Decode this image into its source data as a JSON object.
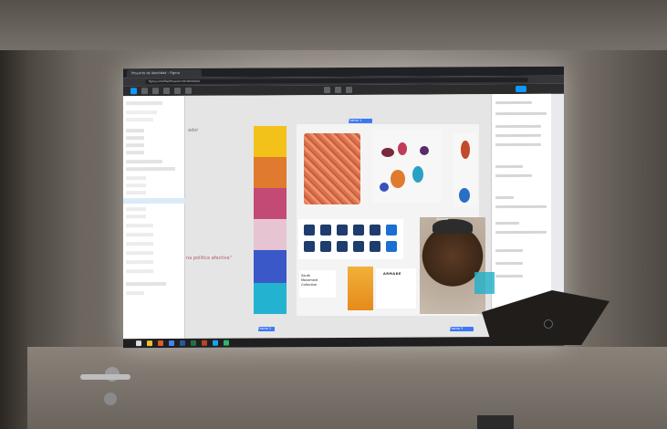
{
  "browser": {
    "tab_title": "Proyecto de Identidad – Figma",
    "url": "figma.com/file/Proyecto-de-Identidad"
  },
  "canvas": {
    "text_left_top": "ador",
    "text_left_mid": "na política afectiva\"",
    "frame_labels": [
      "Frame 1",
      "Frame 2",
      "Frame 3"
    ],
    "book_lines": [
      "South",
      "Movement",
      "Collective"
    ],
    "poster_word": "ARMADE",
    "portrait_caption": "Abrazar"
  },
  "palette": {
    "colors": [
      "#f2c21a",
      "#e07a2e",
      "#c24a74",
      "#e7c4d2",
      "#3a58c7",
      "#23b3d0"
    ]
  },
  "icons": {
    "names": [
      "door-handle-icon",
      "figma-toolbar-icon",
      "taskbar-app-icon"
    ]
  }
}
